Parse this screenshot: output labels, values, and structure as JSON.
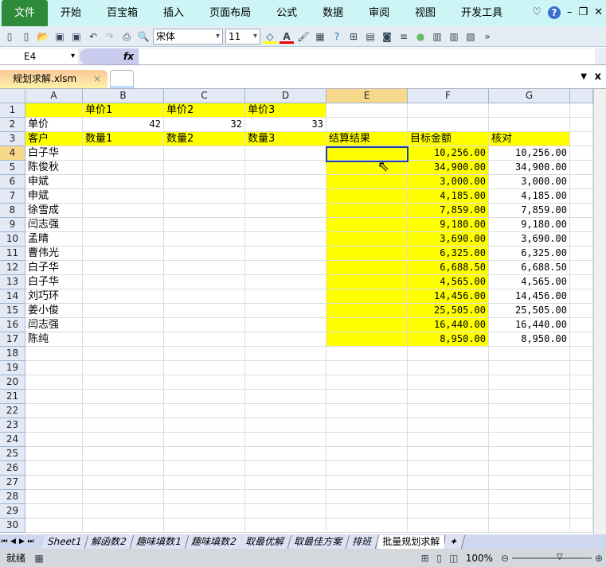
{
  "menu": [
    "文件",
    "开始",
    "百宝箱",
    "插入",
    "页面布局",
    "公式",
    "数据",
    "审阅",
    "视图",
    "开发工具"
  ],
  "toolbar": {
    "font": "宋体",
    "size": "11"
  },
  "formula_bar": {
    "name_box": "E4",
    "fx": "fx",
    "value": ""
  },
  "doc_tab": {
    "name": "规划求解.xlsm",
    "close": "×"
  },
  "columns": [
    "A",
    "B",
    "C",
    "D",
    "E",
    "F",
    "G"
  ],
  "active_cell": "E4",
  "rows": [
    [
      "",
      "单价1",
      "单价2",
      "单价3",
      "",
      "",
      ""
    ],
    [
      "单价",
      "42",
      "32",
      "33",
      "",
      "",
      ""
    ],
    [
      "客户",
      "数量1",
      "数量2",
      "数量3",
      "结算结果",
      "目标金额",
      "核对"
    ],
    [
      "白子华",
      "",
      "",
      "",
      "",
      "10,256.00",
      "10,256.00"
    ],
    [
      "陈俊秋",
      "",
      "",
      "",
      "",
      "34,900.00",
      "34,900.00"
    ],
    [
      "申斌",
      "",
      "",
      "",
      "",
      "3,000.00",
      "3,000.00"
    ],
    [
      "申斌",
      "",
      "",
      "",
      "",
      "4,185.00",
      "4,185.00"
    ],
    [
      "徐雪成",
      "",
      "",
      "",
      "",
      "7,859.00",
      "7,859.00"
    ],
    [
      "闫志强",
      "",
      "",
      "",
      "",
      "9,180.00",
      "9,180.00"
    ],
    [
      "孟晴",
      "",
      "",
      "",
      "",
      "3,690.00",
      "3,690.00"
    ],
    [
      "曹伟光",
      "",
      "",
      "",
      "",
      "6,325.00",
      "6,325.00"
    ],
    [
      "白子华",
      "",
      "",
      "",
      "",
      "6,688.50",
      "6,688.50"
    ],
    [
      "白子华",
      "",
      "",
      "",
      "",
      "4,565.00",
      "4,565.00"
    ],
    [
      "刘巧环",
      "",
      "",
      "",
      "",
      "14,456.00",
      "14,456.00"
    ],
    [
      "姜小俊",
      "",
      "",
      "",
      "",
      "25,505.00",
      "25,505.00"
    ],
    [
      "闫志强",
      "",
      "",
      "",
      "",
      "16,440.00",
      "16,440.00"
    ],
    [
      "陈纯",
      "",
      "",
      "",
      "",
      "8,950.00",
      "8,950.00"
    ]
  ],
  "total_rows": 30,
  "sheets": [
    "Sheet1",
    "解函数2",
    "趣味填数1",
    "趣味填数2",
    "取最优解",
    "取最佳方案",
    "排班",
    "批量规划求解"
  ],
  "active_sheet": "批量规划求解",
  "status": {
    "ready": "就绪",
    "zoom": "100%"
  },
  "colors": {
    "highlight": "#ffff00",
    "menubar": "#cdf5f5"
  }
}
